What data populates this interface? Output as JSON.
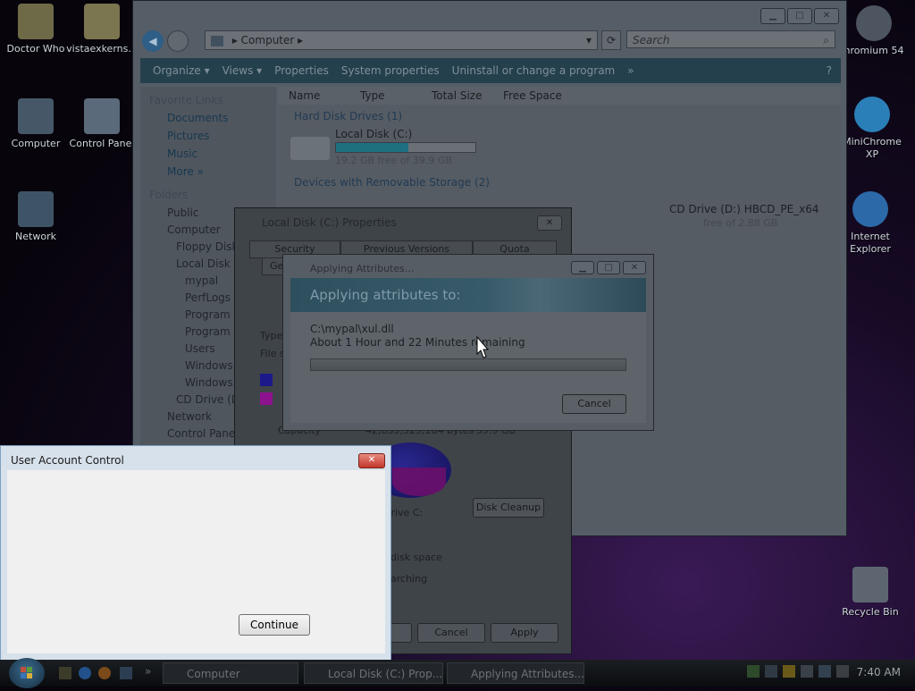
{
  "desktop": {
    "icons": [
      {
        "label": "Doctor Who"
      },
      {
        "label": "vistaexkerns..."
      },
      {
        "label": "Computer"
      },
      {
        "label": "Control Panel"
      },
      {
        "label": "Network"
      },
      {
        "label": "hromium 54"
      },
      {
        "label": "MiniChrome XP"
      },
      {
        "label": "Internet Explorer"
      },
      {
        "label": "Recycle Bin"
      }
    ]
  },
  "explorer": {
    "address": "Computer",
    "search_placeholder": "Search",
    "toolbar": [
      "Organize ▾",
      "Views ▾",
      "Properties",
      "System properties",
      "Uninstall or change a program",
      "»"
    ],
    "nav": {
      "favorite_links": "Favorite Links",
      "links": [
        "Documents",
        "Pictures",
        "Music",
        "More »"
      ],
      "folders": "Folders",
      "tree": [
        "Public",
        "Computer",
        "Floppy Disk",
        "Local Disk (C",
        "mypal",
        "PerfLogs",
        "Program F",
        "Program F",
        "Users",
        "Windows",
        "Windows.o",
        "CD Drive (D:",
        "Network",
        "Control Panel"
      ]
    },
    "columns": [
      "Name",
      "Type",
      "Total Size",
      "Free Space"
    ],
    "groups": {
      "hdd": "Hard Disk Drives (1)",
      "removable": "Devices with Removable Storage (2)"
    },
    "drive_c": {
      "name": "Local Disk (C:)",
      "free": "19.2 GB free of 39.9 GB",
      "used_fraction": 0.52
    },
    "drive_d": {
      "name": "CD Drive (D:) HBCD_PE_x64",
      "free": "free of 2.88 GB"
    }
  },
  "properties": {
    "title": "Local Disk (C:) Properties",
    "tabs": [
      "Security",
      "Previous Versions",
      "Quota",
      "Ge"
    ],
    "type_label": "Type",
    "fs_label": "File sy",
    "capacity_label": "Capacity",
    "capacity_value": "42,855,525,184 bytes",
    "capacity_gb": "39.9 GB",
    "drive_label": "Drive C:",
    "disk_cleanup": "Disk Cleanup",
    "compress": "disk space",
    "index": "arching",
    "buttons": {
      "ok": "OK",
      "cancel": "Cancel",
      "apply": "Apply"
    }
  },
  "applying": {
    "title": "Applying Attributes...",
    "banner": "Applying attributes to:",
    "file": "C:\\mypal\\xul.dll",
    "remaining": "About 1 Hour and 22 Minutes remaining",
    "progress": 0,
    "cancel": "Cancel"
  },
  "uac": {
    "title": "User Account Control",
    "continue": "Continue"
  },
  "taskbar": {
    "tasks": [
      "Computer",
      "Local Disk (C:) Prop...",
      "Applying Attributes..."
    ],
    "clock": "7:40 AM"
  }
}
